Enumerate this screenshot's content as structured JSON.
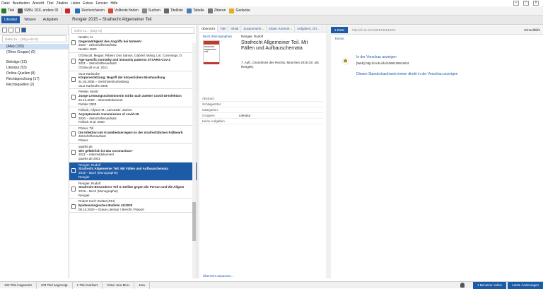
{
  "menu": [
    "Datei",
    "Bearbeiten",
    "Ansicht",
    "Titel",
    "Zitation",
    "Listen",
    "Extras",
    "Fenster",
    "Hilfe"
  ],
  "toolbar": {
    "titel": "Titel",
    "isbn": "ISBN, DOI, andere ID",
    "recherchieren": "Recherchieren",
    "volltexte": "Volltexte finden",
    "suchen": "Suchen",
    "titelliste": "Titelliste",
    "tabelle": "Tabelle",
    "zitieren": "Zitieren",
    "gedanke": "Gedanke"
  },
  "tabs": {
    "literatur": "Literatur",
    "wissen": "Wissen",
    "aufgaben": "Aufgaben"
  },
  "breadcrumb": "Rengier 2015 – Strafrecht Allgemeiner Teil",
  "left": {
    "search_placeholder": "Gehe zu... (Strg+Alt+G)",
    "categories": [
      "(Alle) (103)",
      "(Ohne Gruppe) (0)",
      "",
      "Beiträge (22)",
      "Literatur (53)",
      "Online-Quellen (8)",
      "Rechtsprechung (17)",
      "Rechtsquellen (2)"
    ]
  },
  "list": {
    "search_placeholder": "Gehe zu... (Strg+G)",
    "items": [
      {
        "l1": "Nestler, N.",
        "l2": "Gegenwärtigkeit des Angriffs bei Notwehr",
        "l3": "2020 – Zeitschriftenaufsatz",
        "l4": "Nestler 2020"
      },
      {
        "l1": "O'Driscoll, Megan; Ribeiro Dos Santos, Gabriel; Wang, Lin; Cummings, D",
        "l2": "Age-specific mortality and immunity patterns of SARS-CoV-2",
        "l3": "2021 – Zeitschriftenaufsatz",
        "l4": "O'Driscoll et al. 2021"
      },
      {
        "l1": "OLG Karlsruhe",
        "l2": "Körperverletzung: Begriff der körperlichen Misshandlung",
        "l3": "31.03.2005 – Gerichtsentscheidung",
        "l4": "OLG Karlsruhe 2005"
      },
      {
        "l1": "Piehler, Moritz",
        "l2": "Junge Leistungsschwimmerin stirbt nach zweiter Covid-19-Infektion",
        "l3": "22.12.2020 – Internetdokument",
        "l4": "Piehler 2020"
      },
      {
        "l1": "Pollock, Allyson M.; Lancaster, James",
        "l2": "Asymptomatic transmission of covid-19",
        "l3": "2020 – Zeitschriftenaufsatz",
        "l4": "Pollock et al. 2020"
      },
      {
        "l1": "Pömer, Till",
        "l2": "Die Infektion mit Krankheitserregern in der strafrechtlichen Fallbearb",
        "l3": "Zeitschriftenaufsatz",
        "l4": "Pömer"
      },
      {
        "l1": "quarks.de",
        "l2": "Wie gefährlich ist das Coronavirus?",
        "l3": "2021 – Internetdokument",
        "l4": "quarks.de 2021"
      },
      {
        "l1": "Rengier, Rudolf",
        "l2": "Strafrecht Allgemeiner Teil. Mit Fällen und Aufbauschemata",
        "l3": "2015 – Buch (Monographie)",
        "l4": "Rengier"
      },
      {
        "l1": "Rengier, Rudolf",
        "l2": "Strafrecht Besonderer Teil II. Delikte gegen die Person und die Allgem",
        "l3": "2019 – Buch (Monographie)",
        "l4": "Rengier"
      },
      {
        "l1": "Robert Koch-Institut (RKI)",
        "l2": "Epidemiologisches Bulletin 41/2020",
        "l3": "08.10.2020 – Graue Literatur / Bericht / Report",
        "l4": ""
      }
    ]
  },
  "detail": {
    "tabs": [
      "Übersicht",
      "Titel",
      "Inhalt",
      "Zusammenh...",
      "Zitate, Komme...",
      "Aufgaben, Ort..."
    ],
    "type": "Buch (Monographie)",
    "author": "Rengier, Rudolf",
    "title": "Strafrecht Allgemeiner Teil. Mit Fällen und Aufbauschemata",
    "info": "7. Aufl., Grundrisse des Rechts, München 2015 (zit. als Rengier).",
    "cover_title": "Strafrecht Allgemeiner Teil",
    "fields": [
      {
        "k": "Abstract:",
        "v": ""
      },
      {
        "k": "Schlagwörter:",
        "v": ""
      },
      {
        "k": "Kategorien:",
        "v": ""
      },
      {
        "k": "Gruppen:",
        "v": "Literatur"
      },
      {
        "k": "Keine Aufgaben",
        "v": ""
      }
    ],
    "customize": "Übersicht anpassen..."
  },
  "preview": {
    "source": "1 Datei",
    "url": "http://d-nb.info/1069135615/04",
    "quicklink": "Schnellhilfe",
    "extras": "Extras",
    "show": "In der Vorschau anzeigen",
    "web_label": "[Web]",
    "web_url": "http://d-nb.info/1069135615/04",
    "hint": "Diesen Standortnachweis immer direkt in der Vorschau anzeigen"
  },
  "status": {
    "total": "103 Titel insgesamt",
    "shown": "103 Titel angezeigt",
    "marked": "1 Titel markiert",
    "style": "Citavi Jura MLU",
    "lang": "Jura",
    "users": "1 Benutzer online",
    "changes": "Letzte Änderungen"
  },
  "colors": {
    "accent": "#1e5ba6",
    "chrome": "#4285f4"
  }
}
